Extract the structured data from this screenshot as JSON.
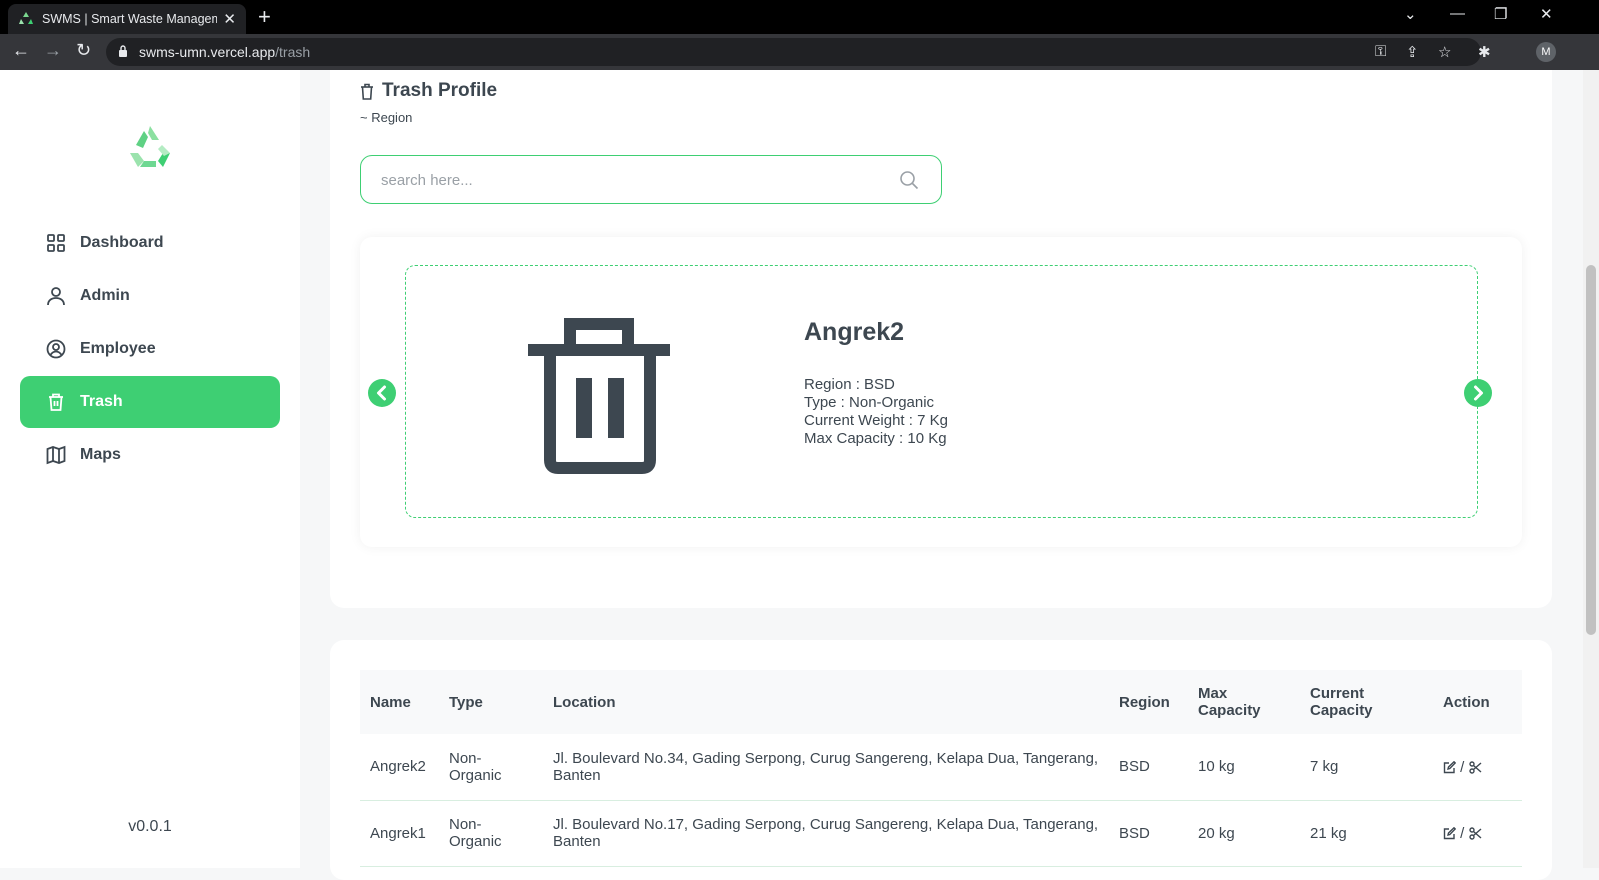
{
  "browser": {
    "tab_title": "SWMS | Smart Waste Management",
    "url_host": "swms-umn.vercel.app",
    "url_path": "/trash",
    "profile_initial": "M"
  },
  "sidebar": {
    "items": [
      {
        "label": "Dashboard",
        "icon": "dashboard-icon"
      },
      {
        "label": "Admin",
        "icon": "user-icon"
      },
      {
        "label": "Employee",
        "icon": "user-circle-icon"
      },
      {
        "label": "Trash",
        "icon": "trash-icon",
        "active": true
      },
      {
        "label": "Maps",
        "icon": "map-icon"
      }
    ],
    "version": "v0.0.1"
  },
  "header": {
    "title": "Trash Profile",
    "subtitle": "~ Region"
  },
  "search": {
    "placeholder": "search here..."
  },
  "carousel": {
    "name": "Angrek2",
    "region_line": "Region : BSD",
    "type_line": "Type : Non-Organic",
    "weight_line": "Current Weight : 7 Kg",
    "capacity_line": "Max Capacity : 10 Kg"
  },
  "table": {
    "headers": {
      "name": "Name",
      "type": "Type",
      "location": "Location",
      "region": "Region",
      "max_capacity": "Max Capacity",
      "current_capacity": "Current Capacity",
      "action": "Action"
    },
    "rows": [
      {
        "name": "Angrek2",
        "type": "Non-Organic",
        "location": "Jl. Boulevard No.34, Gading Serpong, Curug Sangereng, Kelapa Dua, Tangerang, Banten",
        "region": "BSD",
        "max_capacity": "10 kg",
        "current_capacity": "7 kg",
        "action_sep": "/"
      },
      {
        "name": "Angrek1",
        "type": "Non-Organic",
        "location": "Jl. Boulevard No.17, Gading Serpong, Curug Sangereng, Kelapa Dua, Tangerang, Banten",
        "region": "BSD",
        "max_capacity": "20 kg",
        "current_capacity": "21 kg",
        "action_sep": "/"
      }
    ]
  },
  "colors": {
    "accent": "#3ecf73",
    "text": "#3d4750"
  }
}
